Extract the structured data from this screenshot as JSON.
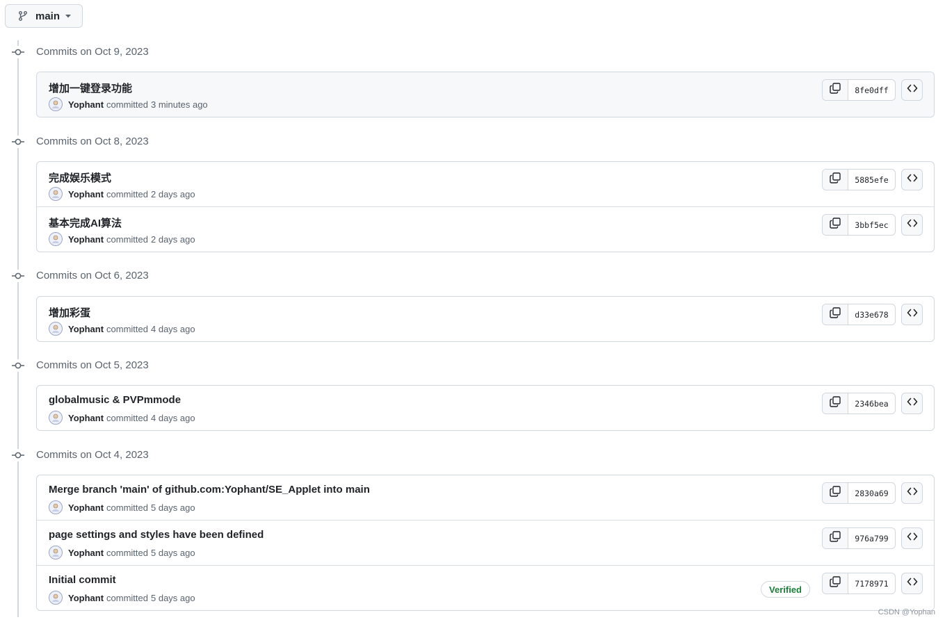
{
  "branch": {
    "label": "main",
    "icon": "git-branch-icon"
  },
  "groups": [
    {
      "title": "Commits on Oct 9, 2023",
      "commits": [
        {
          "message": "增加一键登录功能",
          "author": "Yophant",
          "action": "committed",
          "time": "3 minutes ago",
          "sha": "8fe0dff",
          "highlight": true,
          "verified": false
        }
      ]
    },
    {
      "title": "Commits on Oct 8, 2023",
      "commits": [
        {
          "message": "完成娱乐模式",
          "author": "Yophant",
          "action": "committed",
          "time": "2 days ago",
          "sha": "5885efe",
          "highlight": false,
          "verified": false
        },
        {
          "message": "基本完成AI算法",
          "author": "Yophant",
          "action": "committed",
          "time": "2 days ago",
          "sha": "3bbf5ec",
          "highlight": false,
          "verified": false
        }
      ]
    },
    {
      "title": "Commits on Oct 6, 2023",
      "commits": [
        {
          "message": "增加彩蛋",
          "author": "Yophant",
          "action": "committed",
          "time": "4 days ago",
          "sha": "d33e678",
          "highlight": false,
          "verified": false
        }
      ]
    },
    {
      "title": "Commits on Oct 5, 2023",
      "commits": [
        {
          "message": "globalmusic & PVPmmode",
          "author": "Yophant",
          "action": "committed",
          "time": "4 days ago",
          "sha": "2346bea",
          "highlight": false,
          "verified": false
        }
      ]
    },
    {
      "title": "Commits on Oct 4, 2023",
      "commits": [
        {
          "message": "Merge branch 'main' of github.com:Yophant/SE_Applet into main",
          "author": "Yophant",
          "action": "committed",
          "time": "5 days ago",
          "sha": "2830a69",
          "highlight": false,
          "verified": false
        },
        {
          "message": "page settings and styles have been defined",
          "author": "Yophant",
          "action": "committed",
          "time": "5 days ago",
          "sha": "976a799",
          "highlight": false,
          "verified": false
        },
        {
          "message": "Initial commit",
          "author": "Yophant",
          "action": "committed",
          "time": "5 days ago",
          "sha": "7178971",
          "highlight": false,
          "verified": true,
          "verified_label": "Verified"
        }
      ]
    }
  ],
  "watermark": "CSDN @Yophan",
  "colors": {
    "accent_verified": "#1a7f37",
    "border": "#d0d7de",
    "muted": "#59636e",
    "highlight_bg": "#f6f8fa"
  }
}
